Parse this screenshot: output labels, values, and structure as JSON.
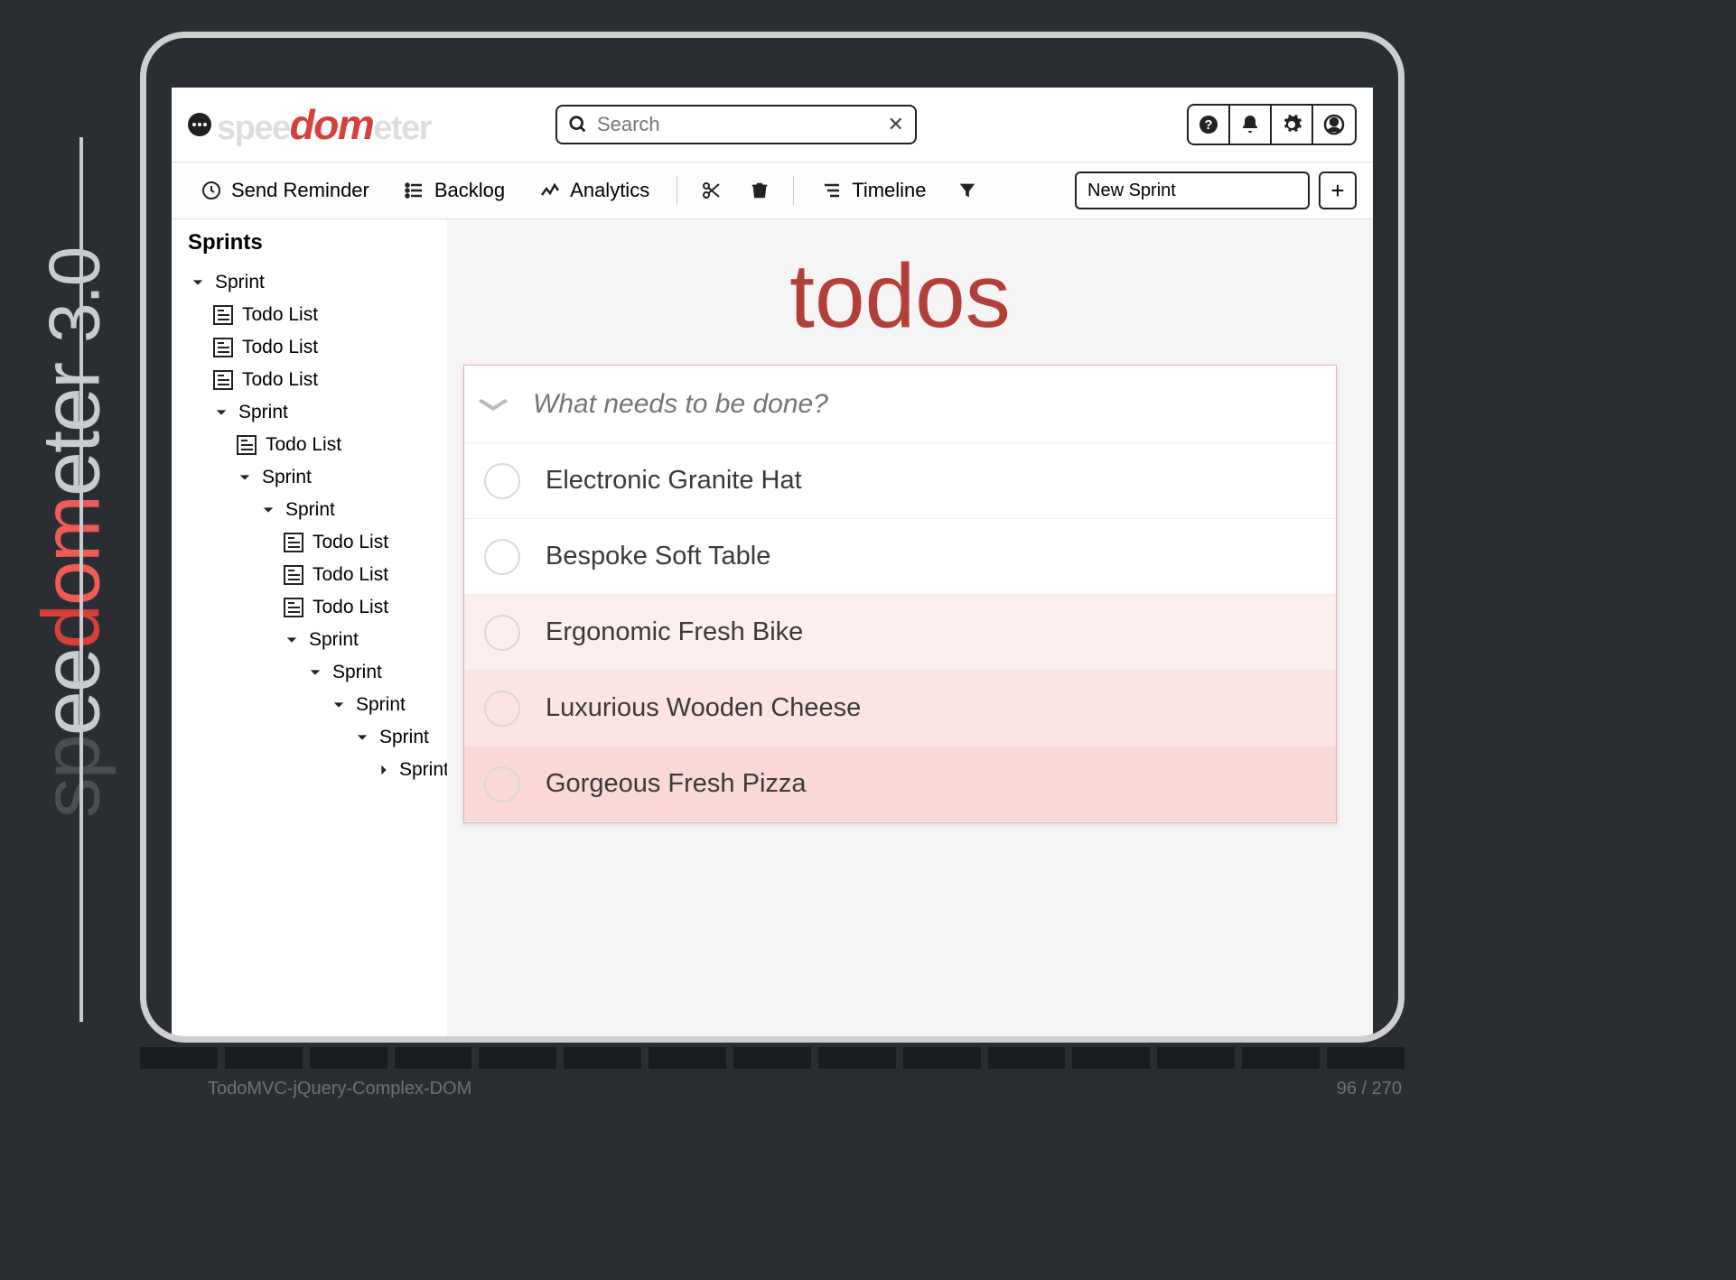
{
  "brand": {
    "version": "3.0"
  },
  "header": {
    "search_placeholder": "Search"
  },
  "toolbar": {
    "send_reminder": "Send Reminder",
    "backlog": "Backlog",
    "analytics": "Analytics",
    "timeline": "Timeline",
    "new_sprint_value": "New Sprint"
  },
  "tree": {
    "title": "Sprints",
    "items": [
      {
        "type": "sprint",
        "label": "Sprint",
        "depth": 0,
        "open": true
      },
      {
        "type": "list",
        "label": "Todo List",
        "depth": 1
      },
      {
        "type": "list",
        "label": "Todo List",
        "depth": 1
      },
      {
        "type": "list",
        "label": "Todo List",
        "depth": 1
      },
      {
        "type": "sprint",
        "label": "Sprint",
        "depth": 1,
        "open": true
      },
      {
        "type": "list",
        "label": "Todo List",
        "depth": 2
      },
      {
        "type": "sprint",
        "label": "Sprint",
        "depth": 2,
        "open": true
      },
      {
        "type": "sprint",
        "label": "Sprint",
        "depth": 3,
        "open": true
      },
      {
        "type": "list",
        "label": "Todo List",
        "depth": 4
      },
      {
        "type": "list",
        "label": "Todo List",
        "depth": 4
      },
      {
        "type": "list",
        "label": "Todo List",
        "depth": 4
      },
      {
        "type": "sprint",
        "label": "Sprint",
        "depth": 4,
        "open": true
      },
      {
        "type": "sprint",
        "label": "Sprint",
        "depth": 5,
        "open": true
      },
      {
        "type": "sprint",
        "label": "Sprint",
        "depth": 6,
        "open": true
      },
      {
        "type": "sprint",
        "label": "Sprint",
        "depth": 7,
        "open": true
      },
      {
        "type": "sprint",
        "label": "Sprint",
        "depth": 8,
        "open": false
      }
    ]
  },
  "main": {
    "title": "todos",
    "new_placeholder": "What needs to be done?",
    "items": [
      "Electronic Granite Hat",
      "Bespoke Soft Table",
      "Ergonomic Fresh Bike",
      "Luxurious Wooden Cheese",
      "Gorgeous Fresh Pizza"
    ]
  },
  "footer": {
    "label": "TodoMVC-jQuery-Complex-DOM",
    "progress_current": 96,
    "progress_total": 270
  }
}
